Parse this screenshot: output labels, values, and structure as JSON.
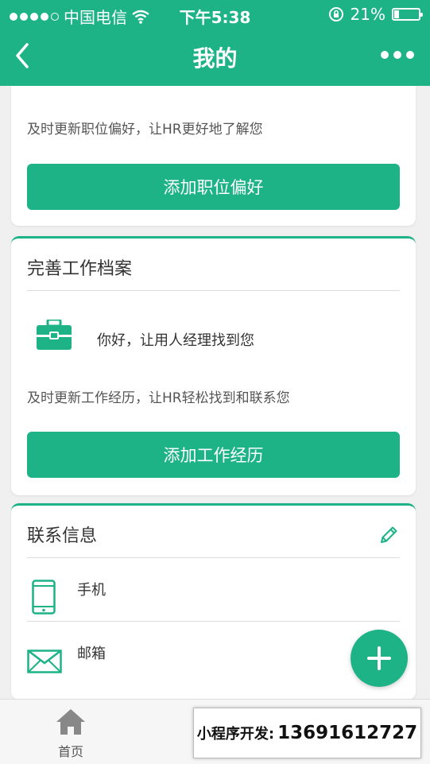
{
  "status_bar": {
    "carrier": "中国电信",
    "time": "下午5:38",
    "battery_percent": "21%",
    "battery_level": 0.21
  },
  "header": {
    "title": "我的"
  },
  "pref_card": {
    "hint": "及时更新职位偏好，让HR更好地了解您",
    "button_label": "添加职位偏好"
  },
  "work_card": {
    "title": "完善工作档案",
    "greeting": "你好，让用人经理找到您",
    "hint": "及时更新工作经历，让HR轻松找到和联系您",
    "button_label": "添加工作经历"
  },
  "contact_card": {
    "title": "联系信息",
    "phone_label": "手机",
    "email_label": "邮箱"
  },
  "tabbar": {
    "home_label": "首页"
  },
  "overlay": {
    "prefix": "小程序开发:",
    "phone": "13691612727"
  },
  "colors": {
    "primary": "#1db387"
  }
}
